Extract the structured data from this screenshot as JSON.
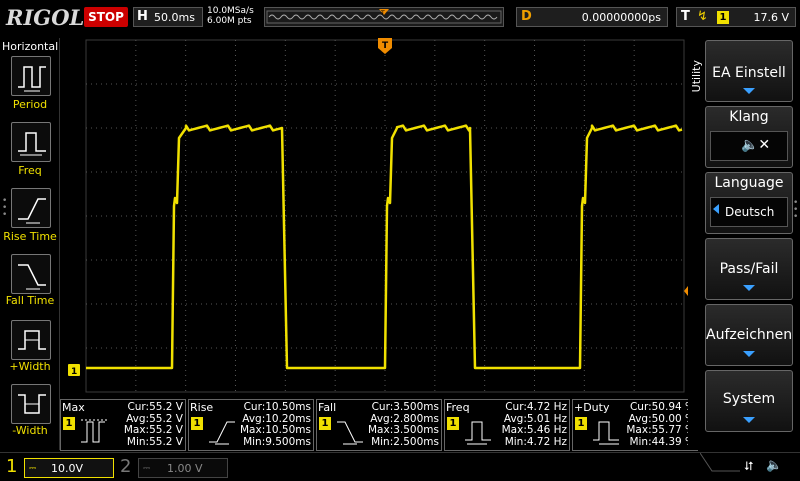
{
  "header": {
    "brand": "RIGOL",
    "run_state": "STOP",
    "horizontal_label": "H",
    "timebase": "50.0ms",
    "sample_rate": "10.0MSa/s",
    "memory_depth": "6.00M pts",
    "delay_label": "D",
    "delay_value": "0.00000000ps",
    "trigger_label": "T",
    "trigger_source": "1",
    "trigger_level": "17.6 V"
  },
  "left_panel": {
    "title": "Horizontal",
    "items": [
      {
        "label": "Period",
        "icon": "period-icon"
      },
      {
        "label": "Freq",
        "icon": "frequency-icon"
      },
      {
        "label": "Rise Time",
        "icon": "rise-time-icon"
      },
      {
        "label": "Fall Time",
        "icon": "fall-time-icon"
      },
      {
        "label": "+Width",
        "icon": "positive-width-icon"
      },
      {
        "label": "-Width",
        "icon": "negative-width-icon"
      }
    ]
  },
  "waveform": {
    "channel": "1",
    "trace_color": "#f0e000",
    "trigger_marker": "T"
  },
  "measurements": [
    {
      "name": "Max",
      "channel": "1",
      "cur": "Cur:55.2 V",
      "avg": "Avg:55.2 V",
      "max": "Max:55.2 V",
      "min": "Min:55.2 V"
    },
    {
      "name": "Rise",
      "channel": "1",
      "cur": "Cur:10.50ms",
      "avg": "Avg:10.20ms",
      "max": "Max:10.50ms",
      "min": "Min:9.500ms"
    },
    {
      "name": "Fall",
      "channel": "1",
      "cur": "Cur:3.500ms",
      "avg": "Avg:2.800ms",
      "max": "Max:3.500ms",
      "min": "Min:2.500ms"
    },
    {
      "name": "Freq",
      "channel": "1",
      "cur": "Cur:4.72 Hz",
      "avg": "Avg:5.01 Hz",
      "max": "Max:5.46 Hz",
      "min": "Min:4.72 Hz"
    },
    {
      "name": "+Duty",
      "channel": "1",
      "cur": "Cur:50.94 %",
      "avg": "Avg:50.00 %",
      "max": "Max:55.77 %",
      "min": "Min:44.39 %"
    }
  ],
  "right_menu": {
    "title": "Utility",
    "items": [
      {
        "label": "EA Einstell"
      },
      {
        "label": "Klang"
      },
      {
        "label": "Language",
        "value": "Deutsch"
      },
      {
        "label": "Pass/Fail"
      },
      {
        "label": "Aufzeichnen"
      },
      {
        "label": "System"
      }
    ]
  },
  "channels": {
    "ch1": {
      "number": "1",
      "scale": "10.0V"
    },
    "ch2": {
      "number": "2",
      "scale": "1.00 V"
    }
  },
  "colors": {
    "channel1": "#f0e000",
    "trigger_orange": "#f08c00",
    "stop_red": "#cc0000",
    "menu_arrow": "#3aa0ff"
  }
}
